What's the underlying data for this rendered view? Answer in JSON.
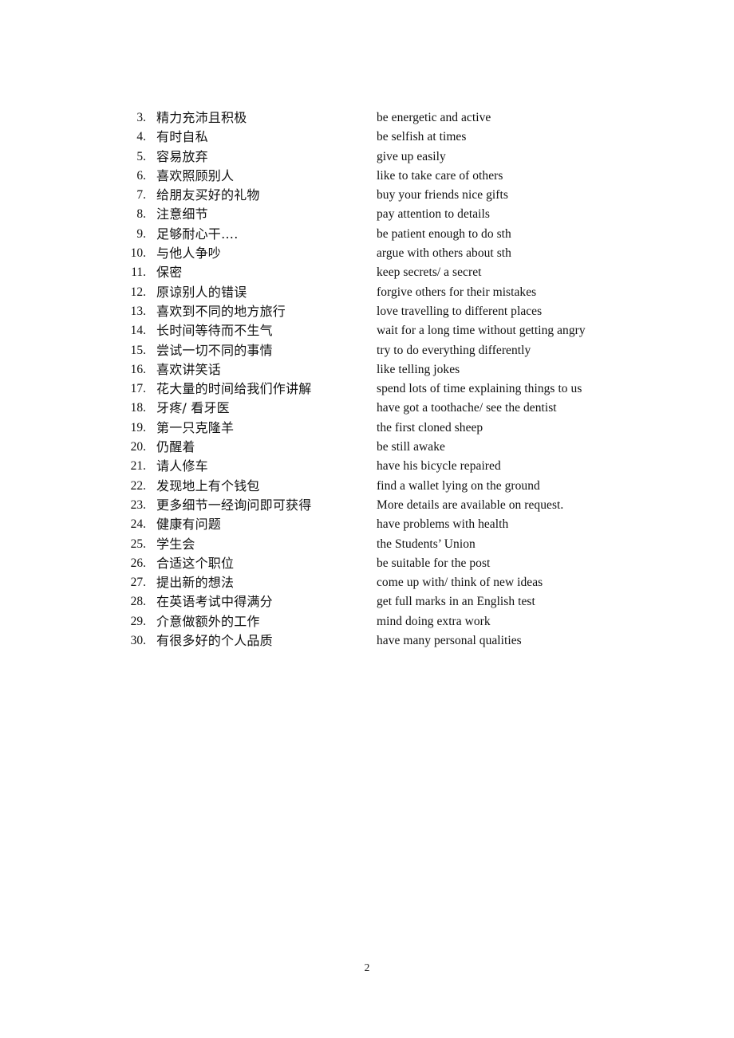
{
  "document": {
    "page_number": "2",
    "background_color": "#ffffff",
    "text_color": "#111111"
  },
  "vocabulary": {
    "items": [
      {
        "number": "3.",
        "chinese": "精力充沛且积极",
        "english": "be energetic and active"
      },
      {
        "number": "4.",
        "chinese": "有时自私",
        "english": "be selfish at times"
      },
      {
        "number": "5.",
        "chinese": "容易放弃",
        "english": "give up easily"
      },
      {
        "number": "6.",
        "chinese": "喜欢照顾别人",
        "english": "like to take care of others"
      },
      {
        "number": "7.",
        "chinese": "给朋友买好的礼物",
        "english": "buy your friends nice gifts"
      },
      {
        "number": "8.",
        "chinese": "注意细节",
        "english": "pay attention to details"
      },
      {
        "number": "9.",
        "chinese": "足够耐心干….",
        "english": "be patient enough to do sth"
      },
      {
        "number": "10.",
        "chinese": "与他人争吵",
        "english": "argue with others about sth"
      },
      {
        "number": "11.",
        "chinese": "保密",
        "english": "keep secrets/ a secret"
      },
      {
        "number": "12.",
        "chinese": "原谅别人的错误",
        "english": "forgive others for their mistakes"
      },
      {
        "number": "13.",
        "chinese": "喜欢到不同的地方旅行",
        "english": "love travelling to different places"
      },
      {
        "number": "14.",
        "chinese": "长时间等待而不生气",
        "english": "wait for a long time without getting angry"
      },
      {
        "number": "15.",
        "chinese": "尝试一切不同的事情",
        "english": "try to do everything differently"
      },
      {
        "number": "16.",
        "chinese": "喜欢讲笑话",
        "english": "like telling jokes"
      },
      {
        "number": "17.",
        "chinese": "花大量的时间给我们作讲解",
        "english": "spend lots of time explaining things to us"
      },
      {
        "number": "18.",
        "chinese": "牙疼/ 看牙医",
        "english": "have got a toothache/ see the dentist"
      },
      {
        "number": "19.",
        "chinese": "第一只克隆羊",
        "english": "the first cloned sheep"
      },
      {
        "number": "20.",
        "chinese": "仍醒着",
        "english": "be still awake"
      },
      {
        "number": "21.",
        "chinese": "请人修车",
        "english": "have his bicycle repaired"
      },
      {
        "number": "22.",
        "chinese": "发现地上有个钱包",
        "english": "find a wallet lying on the ground"
      },
      {
        "number": "23.",
        "chinese": "更多细节一经询问即可获得",
        "english": "More details are available on request."
      },
      {
        "number": "24.",
        "chinese": "健康有问题",
        "english": "have problems with health"
      },
      {
        "number": "25.",
        "chinese": "学生会",
        "english": "the Students’ Union"
      },
      {
        "number": "26.",
        "chinese": "合适这个职位",
        "english": "be suitable for the post"
      },
      {
        "number": "27.",
        "chinese": "提出新的想法",
        "english": "come up with/ think of new ideas"
      },
      {
        "number": "28.",
        "chinese": "在英语考试中得满分",
        "english": "get full marks in an English test"
      },
      {
        "number": "29.",
        "chinese": "介意做额外的工作",
        "english": "mind doing extra work"
      },
      {
        "number": "30.",
        "chinese": "有很多好的个人品质",
        "english": "have many personal qualities"
      }
    ]
  }
}
